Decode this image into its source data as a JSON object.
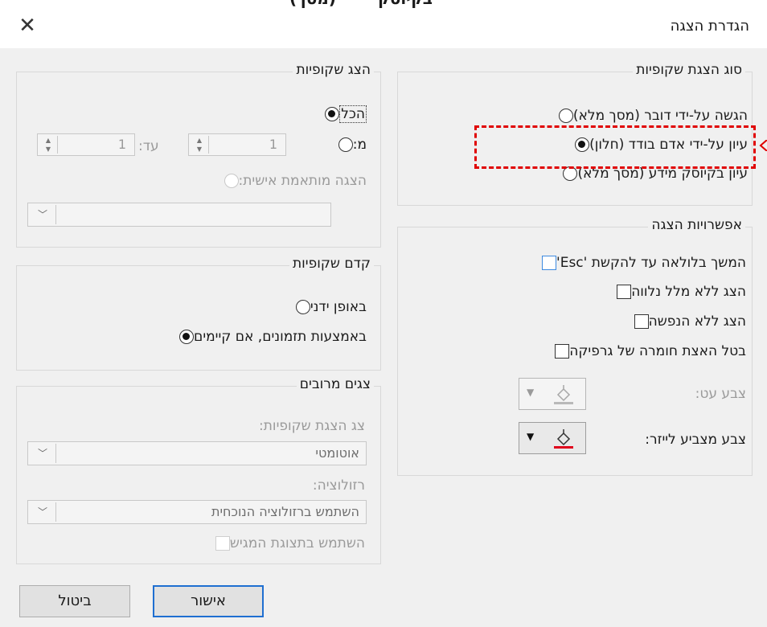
{
  "window": {
    "title": "הגדרת הצגה",
    "top_strip_text": [
      "(מסך)",
      "בקיוסק"
    ]
  },
  "show_type": {
    "title": "סוג הצגת שקופיות",
    "options": [
      {
        "label": "הגשה על-ידי דובר (מסך מלא)",
        "selected": false
      },
      {
        "label": "עיון על-ידי אדם בודד (חלון)",
        "selected": true
      },
      {
        "label": "עיון בקיוסק מידע (מסך מלא)",
        "selected": false
      }
    ]
  },
  "show_slides": {
    "title": "הצג שקופיות",
    "all_label": "הכל",
    "from_label": "מ:",
    "from_value": "1",
    "to_label": "עד:",
    "to_value": "1",
    "custom_label": "הצגה מותאמת אישית:",
    "custom_value": ""
  },
  "show_options": {
    "title": "אפשרויות הצגה",
    "checkboxes": [
      {
        "label": "המשך בלולאה עד להקשת 'Esc'",
        "checked": false
      },
      {
        "label": "הצג ללא מלל נלווה",
        "checked": false
      },
      {
        "label": "הצג ללא הנפשה",
        "checked": false
      },
      {
        "label": "בטל האצת חומרה של גרפיקה",
        "checked": false
      }
    ],
    "pen_color_label": "צבע עט:",
    "laser_color_label": "צבע מצביע לייזר:",
    "laser_color": "#e0001b"
  },
  "advance": {
    "title": "קדם שקופיות",
    "manual_label": "באופן ידני",
    "timings_label": "באמצעות תזמונים, אם קיימים",
    "selected": "timings"
  },
  "multiple_monitors": {
    "title": "צגים מרובים",
    "monitor_label": "צג הצגת שקופיות:",
    "monitor_value": "אוטומטי",
    "resolution_label": "רזולוציה:",
    "resolution_value": "השתמש ברזולוציה הנוכחית",
    "presenter_view_label": "השתמש בתצוגת המגיש"
  },
  "buttons": {
    "ok": "אישור",
    "cancel": "ביטול"
  },
  "colors": {
    "highlight": "#e00000",
    "ok_border": "#1f6fd1"
  }
}
